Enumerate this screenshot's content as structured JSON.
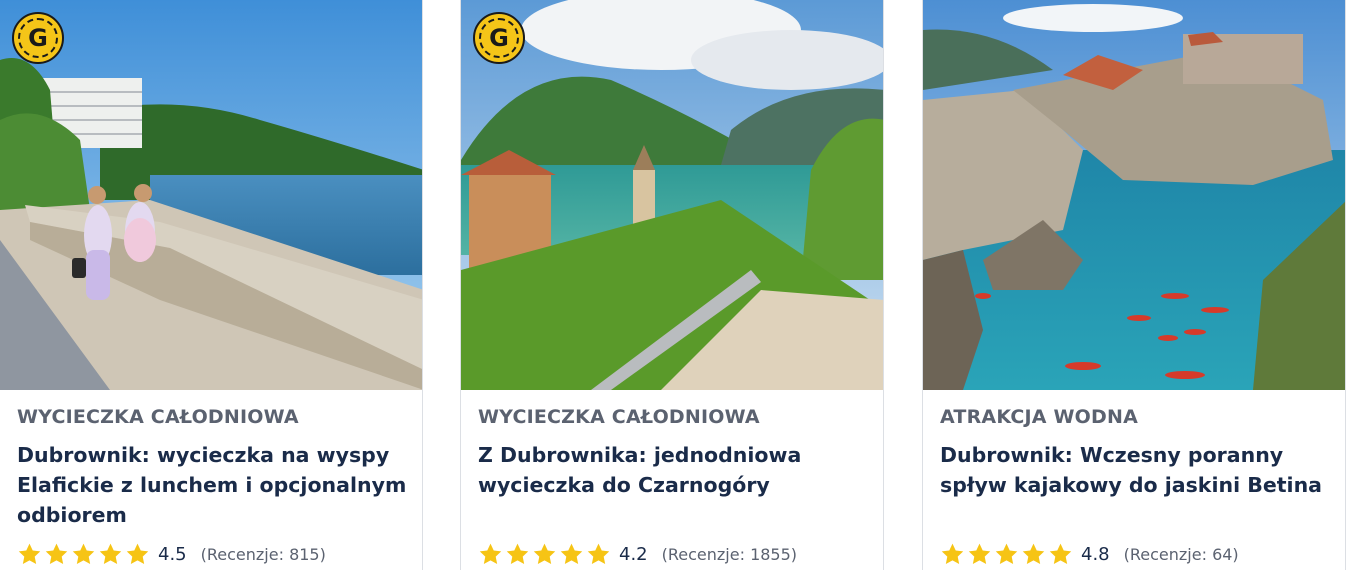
{
  "colors": {
    "star": "#f6c415",
    "title": "#1a2b49",
    "category": "#5b6270",
    "badge": "#f5c518"
  },
  "badge": {
    "letter": "G",
    "icon": "guide-badge-icon"
  },
  "cards": [
    {
      "category": "WYCIECZKA CAŁODNIOWA",
      "title": "Dubrownik: wycieczka na wyspy Elafickie z lunchem i opcjonalnym odbiorem",
      "rating": 4.5,
      "rating_text": "4.5",
      "reviews": "(Recenzje: 815)",
      "has_badge": true
    },
    {
      "category": "WYCIECZKA CAŁODNIOWA",
      "title": "Z Dubrownika: jednodniowa wycieczka do Czarnogóry",
      "rating": 4.2,
      "rating_text": "4.2",
      "reviews": "(Recenzje: 1855)",
      "has_badge": true
    },
    {
      "category": "ATRAKCJA WODNA",
      "title": "Dubrownik: Wczesny poranny spływ kajakowy do jaskini Betina",
      "rating": 4.8,
      "rating_text": "4.8",
      "reviews": "(Recenzje: 64)",
      "has_badge": false
    }
  ]
}
